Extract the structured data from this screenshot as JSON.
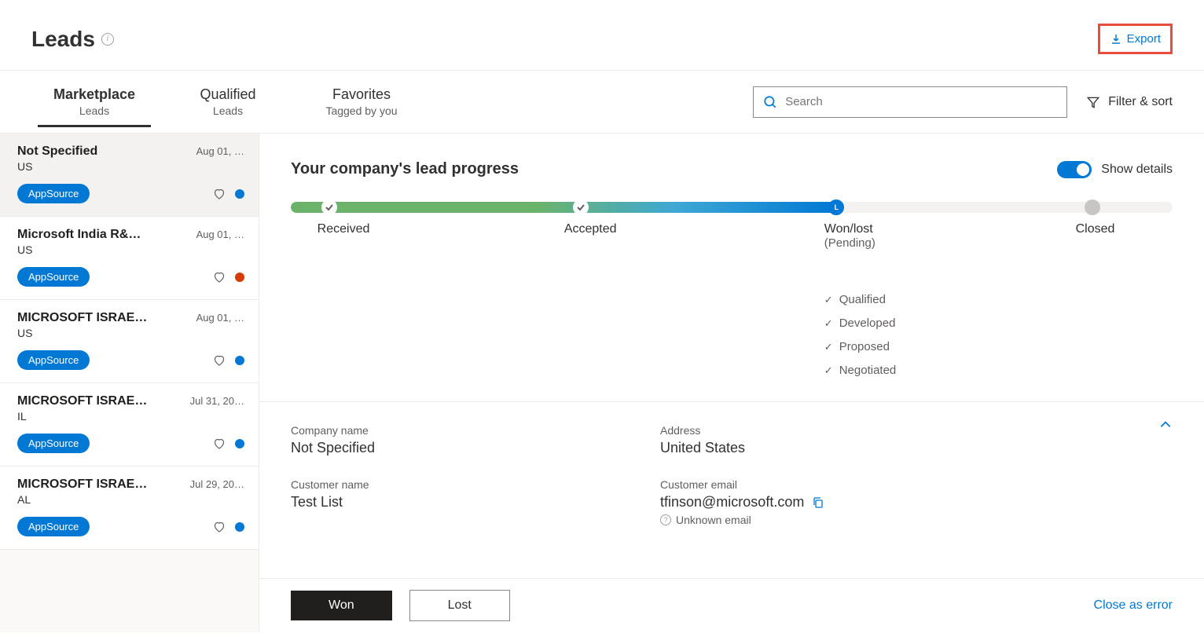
{
  "header": {
    "title": "Leads",
    "export_label": "Export"
  },
  "tabs": [
    {
      "title": "Marketplace",
      "sub": "Leads",
      "active": true
    },
    {
      "title": "Qualified",
      "sub": "Leads",
      "active": false
    },
    {
      "title": "Favorites",
      "sub": "Tagged by you",
      "active": false
    }
  ],
  "search": {
    "placeholder": "Search"
  },
  "filter_label": "Filter & sort",
  "leads": [
    {
      "title": "Not Specified",
      "date": "Aug 01, …",
      "sub": "US",
      "badge": "AppSource",
      "dot": "blue",
      "selected": true
    },
    {
      "title": "Microsoft India R&…",
      "date": "Aug 01, …",
      "sub": "US",
      "badge": "AppSource",
      "dot": "orange",
      "selected": false
    },
    {
      "title": "MICROSOFT ISRAE…",
      "date": "Aug 01, …",
      "sub": "US",
      "badge": "AppSource",
      "dot": "blue",
      "selected": false
    },
    {
      "title": "MICROSOFT ISRAE…",
      "date": "Jul 31, 20…",
      "sub": "IL",
      "badge": "AppSource",
      "dot": "blue",
      "selected": false
    },
    {
      "title": "MICROSOFT ISRAE…",
      "date": "Jul 29, 20…",
      "sub": "AL",
      "badge": "AppSource",
      "dot": "blue",
      "selected": false
    }
  ],
  "progress": {
    "title": "Your company's lead progress",
    "toggle_label": "Show details",
    "stages": [
      {
        "label": "Received"
      },
      {
        "label": "Accepted"
      },
      {
        "label": "Won/lost",
        "pending": "(Pending)"
      },
      {
        "label": "Closed"
      }
    ],
    "checklist": [
      "Qualified",
      "Developed",
      "Proposed",
      "Negotiated"
    ]
  },
  "details": {
    "company_name_label": "Company name",
    "company_name": "Not Specified",
    "address_label": "Address",
    "address": "United States",
    "customer_name_label": "Customer name",
    "customer_name": "Test List",
    "customer_email_label": "Customer email",
    "customer_email": "tfinson@microsoft.com",
    "email_note": "Unknown email"
  },
  "actions": {
    "won": "Won",
    "lost": "Lost",
    "close_error": "Close as error"
  }
}
